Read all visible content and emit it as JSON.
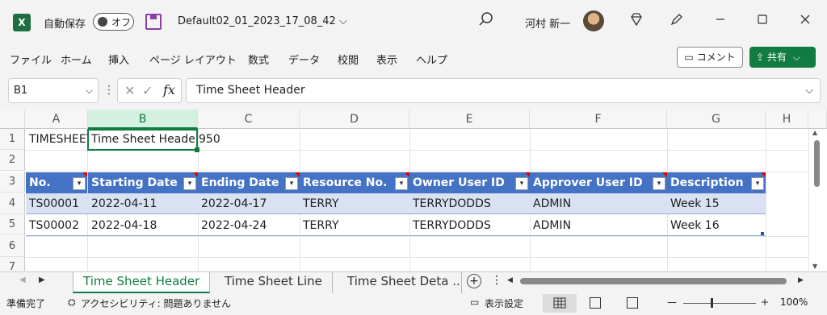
{
  "titlebar": {
    "app_logo": "X",
    "autosave_label": "自動保存",
    "autosave_state": "オフ",
    "filename": "Default02_01_2023_17_08_42",
    "filename_chevron": "⌵",
    "username": "河村 新一",
    "icons": [
      "search-icon",
      "diamond-icon",
      "pen-icon",
      "minimize-icon",
      "maximize-icon",
      "close-icon"
    ]
  },
  "menu": {
    "items": [
      "ファイル",
      "ホーム",
      "挿入",
      "ページ レイアウト",
      "数式",
      "データ",
      "校閲",
      "表示",
      "ヘルプ"
    ],
    "comment_label": "コメント",
    "share_label": "共有"
  },
  "formula_bar": {
    "namebox_value": "B1",
    "formula_value": "Time Sheet Header"
  },
  "grid": {
    "columns": [
      "A",
      "B",
      "C",
      "D",
      "E",
      "F",
      "G",
      "H"
    ],
    "rows": [
      "1",
      "2",
      "3",
      "4",
      "5",
      "6",
      "7"
    ],
    "row1": {
      "a": "TIMESHEET",
      "b": "Time Sheet Header",
      "c": "950"
    },
    "table_headers": [
      "No.",
      "Starting Date",
      "Ending Date",
      "Resource No.",
      "Owner User ID",
      "Approver User ID",
      "Description"
    ],
    "table_rows": [
      [
        "TS00001",
        "2022-04-11",
        "2022-04-17",
        "TERRY",
        "TERRYDODDS",
        "ADMIN",
        "Week 15"
      ],
      [
        "TS00002",
        "2022-04-18",
        "2022-04-24",
        "TERRY",
        "TERRYDODDS",
        "ADMIN",
        "Week 16"
      ]
    ],
    "header_color": "#4472c4",
    "band_color": "#d9e1f2"
  },
  "sheets": {
    "tabs": [
      "Time Sheet Header",
      "Time Sheet Line",
      "Time Sheet Deta ..."
    ],
    "active": "Time Sheet Header"
  },
  "statusbar": {
    "ready": "準備完了",
    "accessibility": "アクセシビリティ: 問題ありません",
    "display_settings": "表示設定",
    "zoom": "100%"
  },
  "accent_color": "#107c41"
}
